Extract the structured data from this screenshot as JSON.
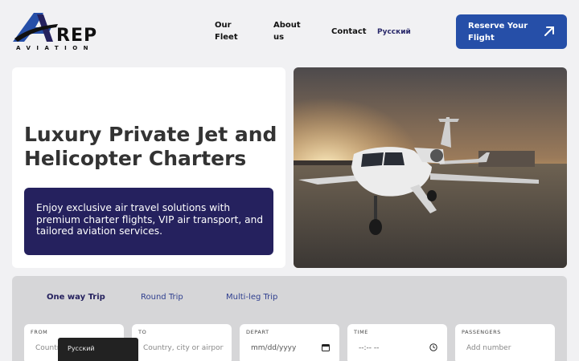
{
  "brand": {
    "wordmark": "REP",
    "tagline": "AVIATION",
    "colors": {
      "navy": "#25215e",
      "accent": "#264fa8"
    }
  },
  "nav": {
    "items": [
      "Our Fleet",
      "About us",
      "Contact"
    ],
    "language": "Русский"
  },
  "cta": {
    "label": "Reserve Your Flight",
    "icon": "arrow-up-right-icon"
  },
  "hero": {
    "title": "Luxury Private Jet and Helicopter Charters",
    "description": "Enjoy exclusive air travel solutions with premium charter flights, VIP air transport, and tailored aviation services."
  },
  "booking": {
    "tabs": [
      "One way Trip",
      "Round Trip",
      "Multi-leg Trip"
    ],
    "active_tab": "One way Trip",
    "fields": {
      "from": {
        "label": "FROM",
        "placeholder": "Country, city or airport"
      },
      "to": {
        "label": "TO",
        "placeholder": "Country, city or airport"
      },
      "depart": {
        "label": "DEPART",
        "placeholder": "mm/dd/yyyy",
        "icon": "calendar-icon"
      },
      "time": {
        "label": "TIME",
        "placeholder": "--:-- --",
        "icon": "clock-icon"
      },
      "passengers": {
        "label": "PASSENGERS",
        "placeholder": "Add number"
      }
    }
  },
  "language_popup": {
    "label": "Русский"
  }
}
